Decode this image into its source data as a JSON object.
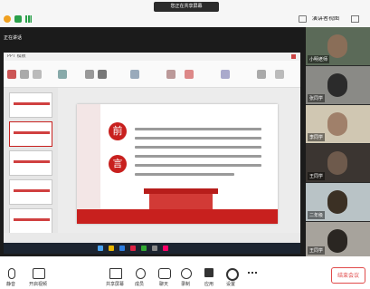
{
  "topbar": {
    "share_status": "您正在共享屏幕",
    "view_label": "演讲者视图"
  },
  "presenter": {
    "label": "正在讲话"
  },
  "ppt": {
    "tab_title": "PPT 模板",
    "slide": {
      "heading_left": "前",
      "heading_right": "言"
    }
  },
  "participants": [
    {
      "name": "小明老师"
    },
    {
      "name": "张同学"
    },
    {
      "name": "李同学"
    },
    {
      "name": "王同学"
    },
    {
      "name": "二年级"
    },
    {
      "name": "王同学"
    }
  ],
  "toolbar": {
    "mute": "静音",
    "video": "开启视频",
    "share": "共享屏幕",
    "members": "成员",
    "chat": "聊天",
    "record": "录制",
    "apps": "应用",
    "settings": "设置",
    "end": "结束会议"
  },
  "colors": {
    "accent": "#c8201e",
    "danger": "#e04a4a"
  }
}
